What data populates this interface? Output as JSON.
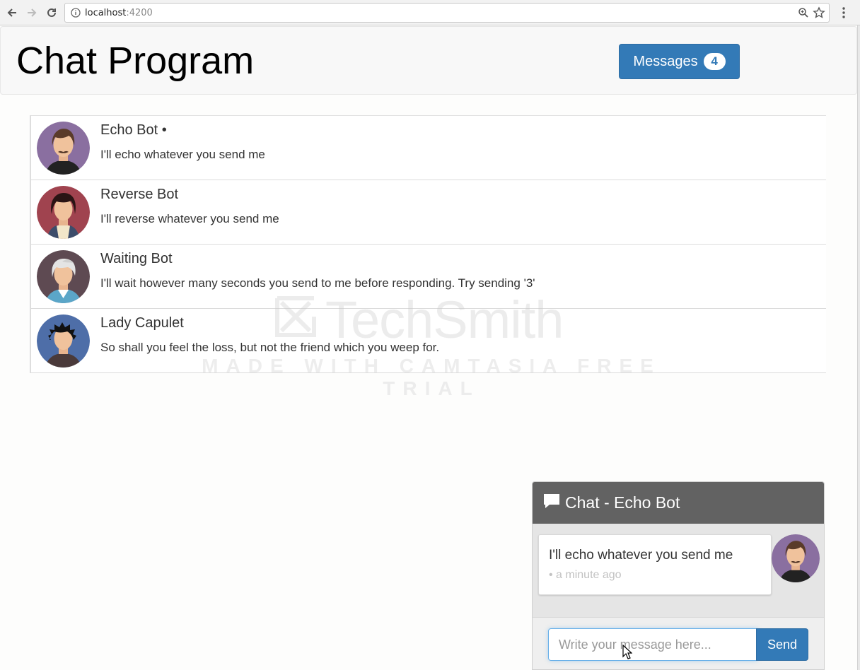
{
  "browser": {
    "url_host": "localhost",
    "url_port": ":4200"
  },
  "navbar": {
    "title": "Chat Program",
    "messages_label": "Messages",
    "messages_count": "4"
  },
  "contacts": [
    {
      "name": "Echo Bot •",
      "description": "I'll echo whatever you send me",
      "avatar_color": "#8a6fa0"
    },
    {
      "name": "Reverse Bot",
      "description": "I'll reverse whatever you send me",
      "avatar_color": "#a0434f"
    },
    {
      "name": "Waiting Bot",
      "description": "I'll wait however many seconds you send to me before responding. Try sending '3'",
      "avatar_color": "#5e4a52"
    },
    {
      "name": "Lady Capulet",
      "description": "So shall you feel the loss, but not the friend which you weep for.",
      "avatar_color": "#4e6ea8"
    }
  ],
  "watermark": {
    "brand": "TechSmith",
    "subtitle": "MADE WITH CAMTASIA FREE TRIAL"
  },
  "chat": {
    "title": "Chat - Echo Bot",
    "message_text": "I'll echo whatever you send me",
    "message_time": "• a minute ago",
    "input_placeholder": "Write your message here...",
    "send_label": "Send"
  },
  "colors": {
    "primary": "#337ab7",
    "chat_header": "#626262"
  }
}
